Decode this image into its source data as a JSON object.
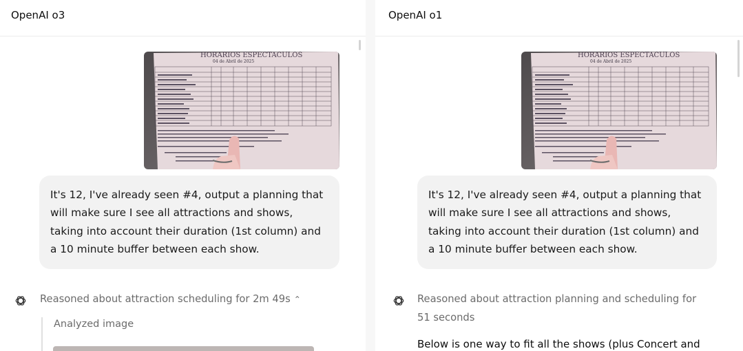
{
  "left_pane": {
    "title": "OpenAI o3",
    "user_message": "It's 12, I've already seen #4, output a planning that will make sure I see all attractions and shows, taking into account their duration (1st column) and a 10 minute buffer between each show.",
    "reasoning_summary": "Reasoned about attraction scheduling for 2m 49s",
    "tool_label": "Analyzed image"
  },
  "right_pane": {
    "title": "OpenAI o1",
    "user_message": "It's 12, I've already seen #4, output a planning that will make sure I see all attractions and shows, taking into account their duration (1st column) and a 10 minute buffer between each show.",
    "reasoning_summary": "Reasoned about attraction planning and scheduling for 51 seconds",
    "answer_start": "Below is one way to fit all the shows (plus Concert and"
  },
  "photo": {
    "heading": "HORARIOS ESPECTACULOS",
    "date": "04 de Abril de 2025",
    "colors": {
      "paper": "#e9dde0",
      "ink": "#2f2a36",
      "background": "#5f5a5c"
    }
  },
  "icons": {
    "assistant": "chatgpt-logo-icon",
    "expand": "chevron-up-icon"
  }
}
